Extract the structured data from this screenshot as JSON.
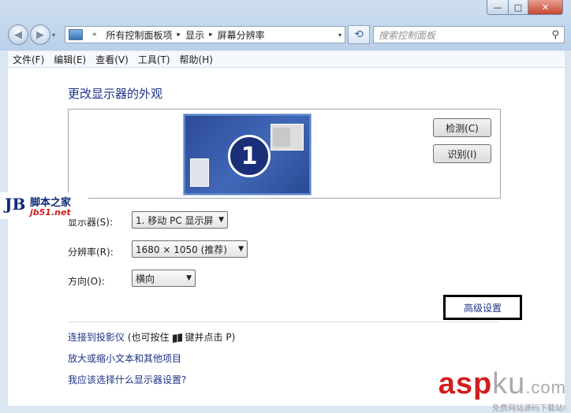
{
  "window": {
    "caption": {
      "minimize": "—",
      "maximize": "□",
      "close": "✕"
    }
  },
  "nav": {
    "back": "◀",
    "forward": "▶",
    "dropdown": "▾",
    "breadcrumb": [
      "«",
      "所有控制面板项",
      "▸",
      "显示",
      "▸",
      "屏幕分辨率"
    ],
    "refresh": "⟲",
    "search_placeholder": "搜索控制面板"
  },
  "menu": [
    "文件(F)",
    "编辑(E)",
    "查看(V)",
    "工具(T)",
    "帮助(H)"
  ],
  "main": {
    "title": "更改显示器的外观",
    "monitor_number": "1",
    "detect_label": "检测(C)",
    "identify_label": "识别(I)",
    "display_label": "显示器(S):",
    "display_value": "1. 移动 PC 显示屏",
    "resolution_label": "分辨率(R):",
    "resolution_value": "1680 × 1050 (推荐)",
    "orientation_label": "方向(O):",
    "orientation_value": "横向",
    "advanced_link": "高级设置",
    "projector_link": "连接到投影仪",
    "projector_note_pre": "(也可按住",
    "projector_note_post": "键并点击 P)",
    "text_size_link": "放大或缩小文本和其他项目",
    "which_settings_link": "我应该选择什么显示器设置?"
  },
  "watermark": {
    "left_mark": "JB",
    "left_text": "脚本之家",
    "left_url": "jb51.net",
    "right_main": "asp",
    "right_ku": "ku",
    "right_com": ".com",
    "right_sub": "免费网站源码下载站!"
  }
}
